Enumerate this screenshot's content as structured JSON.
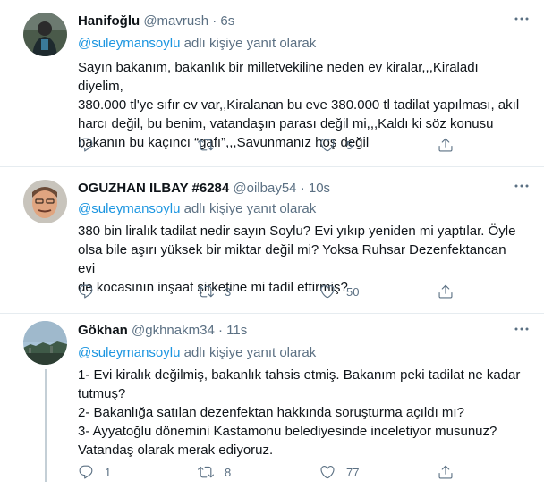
{
  "tweets": [
    {
      "name": "Hanifoğlu",
      "handle": "@mavrush",
      "dot": "·",
      "time": "6s",
      "reply_mention": "@suleymansoylu",
      "reply_suffix": " adlı kişiye yanıt olarak",
      "lines": [
        "Sayın bakanım, bakanlık bir milletvekiline neden ev kiralar,,,Kiraladı diyelim,",
        "380.000 tl'ye sıfır ev var,,Kiralanan bu eve 380.000 tl tadilat yapılması, akıl",
        "harcı değil, bu benim, vatandaşın parası değil mi,,,Kaldı ki söz konusu",
        "bakanın bu kaçıncı “gafı”,,,Savunmanız hoş değil"
      ],
      "replies": "",
      "retweets": "",
      "likes": "5"
    },
    {
      "name": "OGUZHAN ILBAY #6284",
      "handle": "@oilbay54",
      "dot": "·",
      "time": "10s",
      "reply_mention": "@suleymansoylu",
      "reply_suffix": " adlı kişiye yanıt olarak",
      "lines": [
        "380 bin liralık tadilat nedir sayın Soylu? Evi yıkıp yeniden mi yaptılar. Öyle",
        "olsa bile aşırı yüksek bir miktar değil mi? Yoksa Ruhsar Dezenfektancan evi",
        "de kocasının inşaat şirketine mi tadil ettirmiş?"
      ],
      "replies": "",
      "retweets": "3",
      "likes": "50"
    },
    {
      "name": "Gökhan",
      "handle": "@gkhnakm34",
      "dot": "·",
      "time": "11s",
      "reply_mention": "@suleymansoylu",
      "reply_suffix": " adlı kişiye yanıt olarak",
      "lines": [
        "1- Evi kiralık değilmiş, bakanlık tahsis etmiş. Bakanım peki tadilat ne kadar",
        "tutmuş?",
        "2- Bakanlığa satılan dezenfektan hakkında soruşturma açıldı mı?",
        "3- Ayyatoğlu dönemini Kastamonu belediyesinde inceletiyor musunuz?",
        "Vatandaş olarak merak ediyoruz."
      ],
      "replies": "1",
      "retweets": "8",
      "likes": "77"
    }
  ],
  "colors": {
    "text": "#0f1419",
    "secondary": "#5b7083",
    "link": "#1b95e0",
    "divider": "#e6ecf0"
  },
  "icons": [
    "reply-icon",
    "retweet-icon",
    "like-icon",
    "share-icon",
    "more-icon"
  ]
}
